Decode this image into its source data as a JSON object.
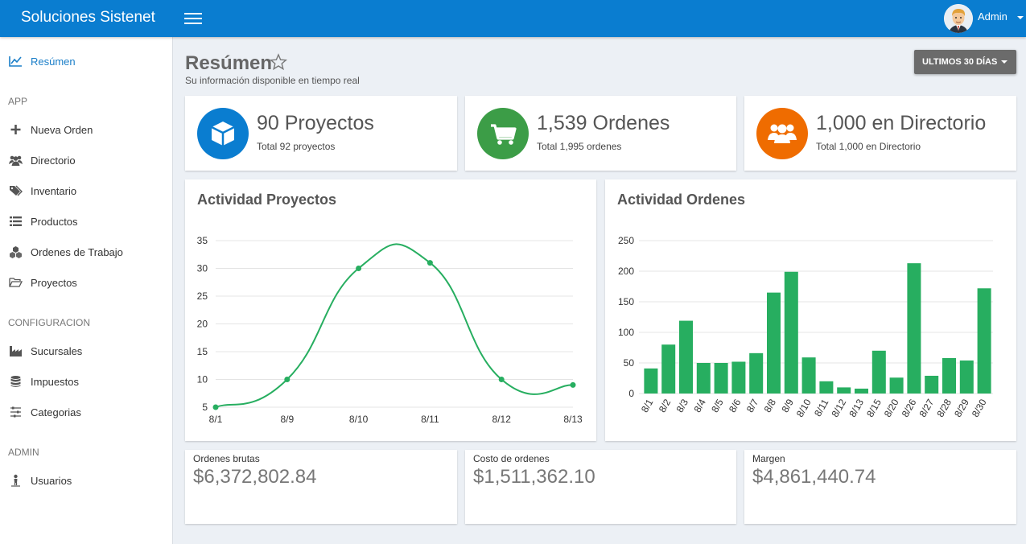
{
  "topbar": {
    "brand": "Soluciones Sistenet",
    "user": "Admin"
  },
  "sidebar": {
    "summary": {
      "label": "Resúmen",
      "icon": "chart-line-icon"
    },
    "sections": [
      {
        "header": "APP",
        "items": [
          {
            "label": "Nueva Orden",
            "icon": "plus-icon"
          },
          {
            "label": "Directorio",
            "icon": "users-icon"
          },
          {
            "label": "Inventario",
            "icon": "tags-icon"
          },
          {
            "label": "Productos",
            "icon": "list-icon"
          },
          {
            "label": "Ordenes de Trabajo",
            "icon": "cubes-icon"
          },
          {
            "label": "Proyectos",
            "icon": "folder-open-icon"
          }
        ]
      },
      {
        "header": "CONFIGURACION",
        "items": [
          {
            "label": "Sucursales",
            "icon": "industry-icon"
          },
          {
            "label": "Impuestos",
            "icon": "database-icon"
          },
          {
            "label": "Categorias",
            "icon": "sliders-icon"
          }
        ]
      },
      {
        "header": "ADMIN",
        "items": [
          {
            "label": "Usuarios",
            "icon": "user-icon"
          }
        ]
      }
    ]
  },
  "header": {
    "title": "Resúmen",
    "subtitle": "Su información disponible en tiempo real",
    "range_button": "ULTIMOS 30 DÍAS"
  },
  "stats": [
    {
      "main": "90 Proyectos",
      "sub": "Total 92 proyectos",
      "color": "#0a7dd0",
      "icon": "cube-icon"
    },
    {
      "main": "1,539 Ordenes",
      "sub": "Total 1,995 ordenes",
      "color": "#3c9d47",
      "icon": "cart-icon"
    },
    {
      "main": "1,000 en Directorio",
      "sub": "Total 1,000 en Directorio",
      "color": "#ef6c00",
      "icon": "users-icon"
    }
  ],
  "charts": {
    "projects_title": "Actividad Proyectos",
    "orders_title": "Actividad Ordenes"
  },
  "chart_data": [
    {
      "type": "line",
      "title": "Actividad Proyectos",
      "categories": [
        "8/1",
        "8/9",
        "8/10",
        "8/11",
        "8/12",
        "8/13"
      ],
      "series": [
        {
          "values": [
            5,
            10,
            30,
            31,
            10,
            9
          ]
        }
      ],
      "ylim": [
        5,
        35
      ],
      "yticks": [
        5,
        10,
        15,
        20,
        25,
        30,
        35
      ],
      "color": "#27ae60",
      "grid": true
    },
    {
      "type": "bar",
      "title": "Actividad Ordenes",
      "categories": [
        "8/1",
        "8/2",
        "8/3",
        "8/4",
        "8/5",
        "8/6",
        "8/7",
        "8/8",
        "8/9",
        "8/10",
        "8/11",
        "8/12",
        "8/13",
        "8/15",
        "8/20",
        "8/26",
        "8/27",
        "8/28",
        "8/29",
        "8/30"
      ],
      "series": [
        {
          "values": [
            41,
            80,
            119,
            50,
            50,
            52,
            66,
            165,
            199,
            59,
            20,
            10,
            8,
            70,
            26,
            213,
            29,
            58,
            54,
            172
          ]
        }
      ],
      "ylim": [
        0,
        250
      ],
      "yticks": [
        0,
        50,
        100,
        150,
        200,
        250
      ],
      "color": "#27ae60",
      "grid": true
    }
  ],
  "financials": [
    {
      "label": "Ordenes brutas",
      "value": "$6,372,802.84"
    },
    {
      "label": "Costo de ordenes",
      "value": "$1,511,362.10"
    },
    {
      "label": "Margen",
      "value": "$4,861,440.74"
    }
  ]
}
